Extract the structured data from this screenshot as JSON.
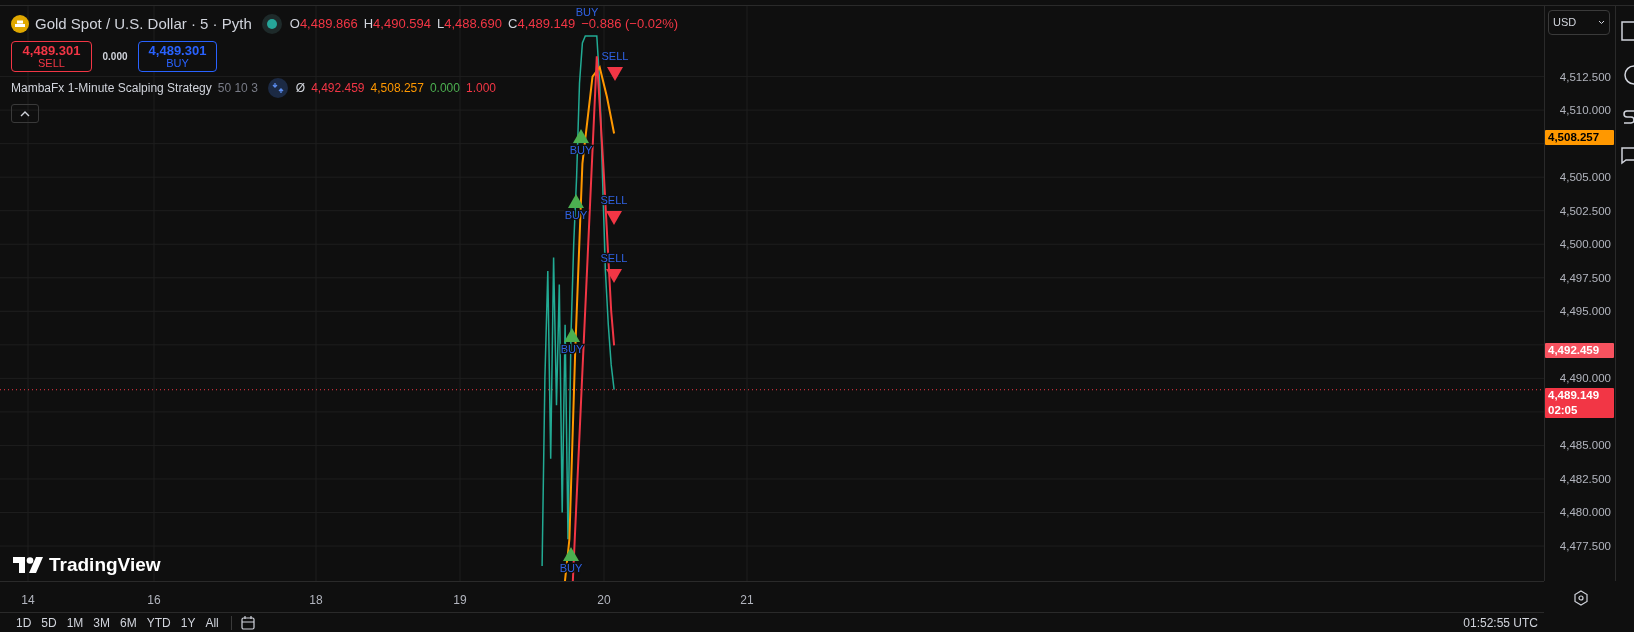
{
  "header": {
    "title": "Gold Spot / U.S. Dollar · 5 · Pyth",
    "market_open": true,
    "ohlc": [
      {
        "key": "O",
        "value": "4,489.866"
      },
      {
        "key": "H",
        "value": "4,490.594"
      },
      {
        "key": "L",
        "value": "4,488.690"
      },
      {
        "key": "C",
        "value": "4,489.149"
      }
    ],
    "change": "−0.886 (−0.02%)"
  },
  "trade": {
    "sell": {
      "price": "4,489.301",
      "label": "SELL"
    },
    "spread": "0.000",
    "buy": {
      "price": "4,489.301",
      "label": "BUY"
    }
  },
  "indicator": {
    "name": "MambaFx 1-Minute Scalping Strategy",
    "params": "50 10 3",
    "symbol": "Ø",
    "values": [
      {
        "text": "4,492.459",
        "color": "#f23645"
      },
      {
        "text": "4,508.257",
        "color": "#ff9800"
      },
      {
        "text": "0.000",
        "color": "#4caf50"
      },
      {
        "text": "1.000",
        "color": "#f23645"
      }
    ]
  },
  "logo": "TradingView",
  "chart": {
    "signals": [
      {
        "kind": "buy",
        "text": "BUY"
      },
      {
        "kind": "sell",
        "text": "SELL"
      },
      {
        "kind": "buy",
        "text": "BUY"
      },
      {
        "kind": "buy",
        "text": "BUY"
      },
      {
        "kind": "sell",
        "text": "SELL"
      },
      {
        "kind": "sell",
        "text": "SELL"
      },
      {
        "kind": "buy",
        "text": "BUY"
      },
      {
        "kind": "buy",
        "text": "BUY"
      }
    ]
  },
  "price_axis": {
    "currency": "USD",
    "labels": [
      "4,512.500",
      "4,510.000",
      "4,505.000",
      "4,502.500",
      "4,500.000",
      "4,497.500",
      "4,495.000",
      "4,490.000",
      "4,485.000",
      "4,482.500",
      "4,480.000",
      "4,477.500"
    ],
    "badges": [
      {
        "text": "4,508.257",
        "color": "#ff9800"
      },
      {
        "text": "4,492.459",
        "color": "#f7525f"
      },
      {
        "text": "4,489.149",
        "sub": "02:05",
        "color": "#f23645"
      }
    ]
  },
  "time_axis": {
    "labels": [
      "14",
      "16",
      "18",
      "19",
      "20",
      "21"
    ]
  },
  "bottom_bar": {
    "ranges": [
      "1D",
      "5D",
      "1M",
      "3M",
      "6M",
      "YTD",
      "1Y",
      "All"
    ],
    "time": "01:52:55 UTC"
  }
}
